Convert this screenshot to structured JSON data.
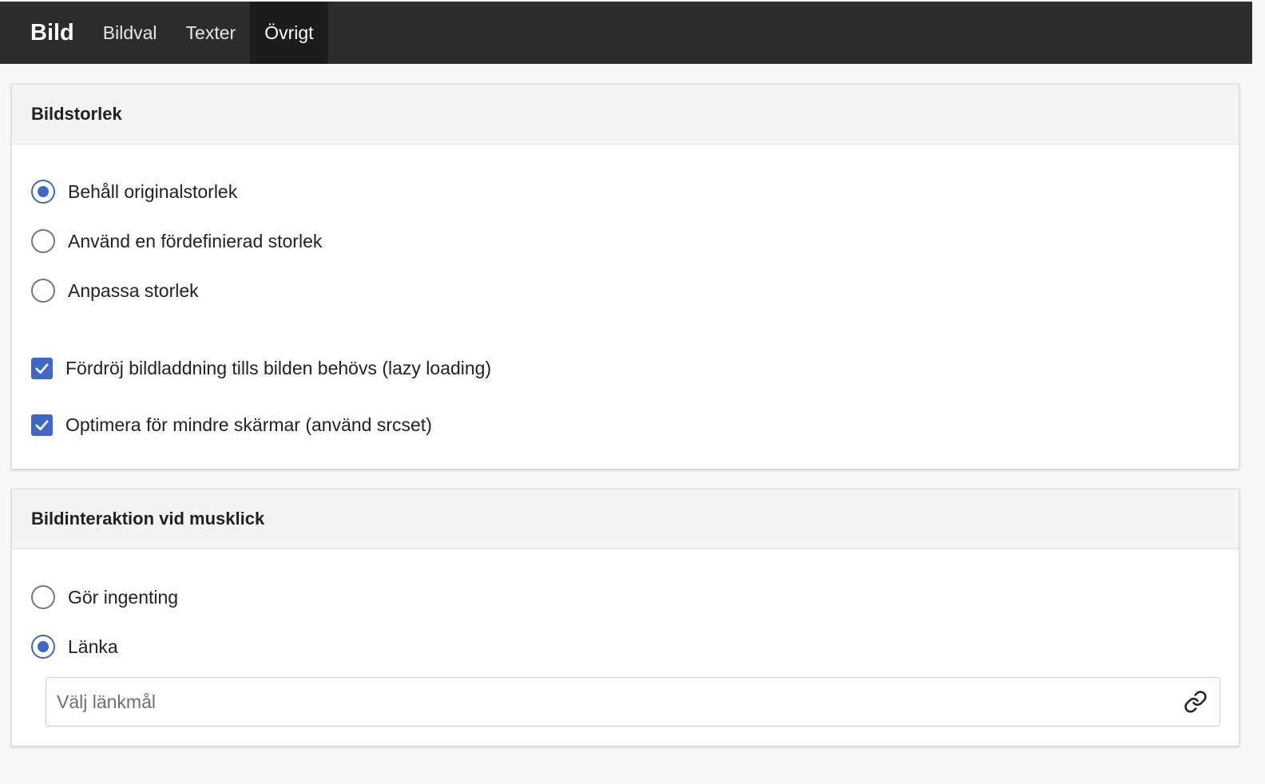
{
  "topbar": {
    "title": "Bild",
    "tabs": [
      {
        "label": "Bildval",
        "active": false
      },
      {
        "label": "Texter",
        "active": false
      },
      {
        "label": "Övrigt",
        "active": true
      }
    ]
  },
  "size_section": {
    "title": "Bildstorlek",
    "options": [
      {
        "label": "Behåll originalstorlek",
        "checked": true
      },
      {
        "label": "Använd en fördefinierad storlek",
        "checked": false
      },
      {
        "label": "Anpassa storlek",
        "checked": false
      }
    ],
    "checkboxes": [
      {
        "label": "Fördröj bildladdning tills bilden behövs (lazy loading)",
        "checked": true
      },
      {
        "label": "Optimera för mindre skärmar (använd srcset)",
        "checked": true
      }
    ]
  },
  "click_section": {
    "title": "Bildinteraktion vid musklick",
    "options": [
      {
        "label": "Gör ingenting",
        "checked": false
      },
      {
        "label": "Länka",
        "checked": true
      }
    ],
    "link_field": {
      "placeholder": "Välj länkmål",
      "value": "",
      "icon": "link-icon"
    }
  },
  "colors": {
    "accent": "#3f67c9",
    "topbar": "#2c2c2c",
    "active_tab": "#1c1c1c"
  }
}
